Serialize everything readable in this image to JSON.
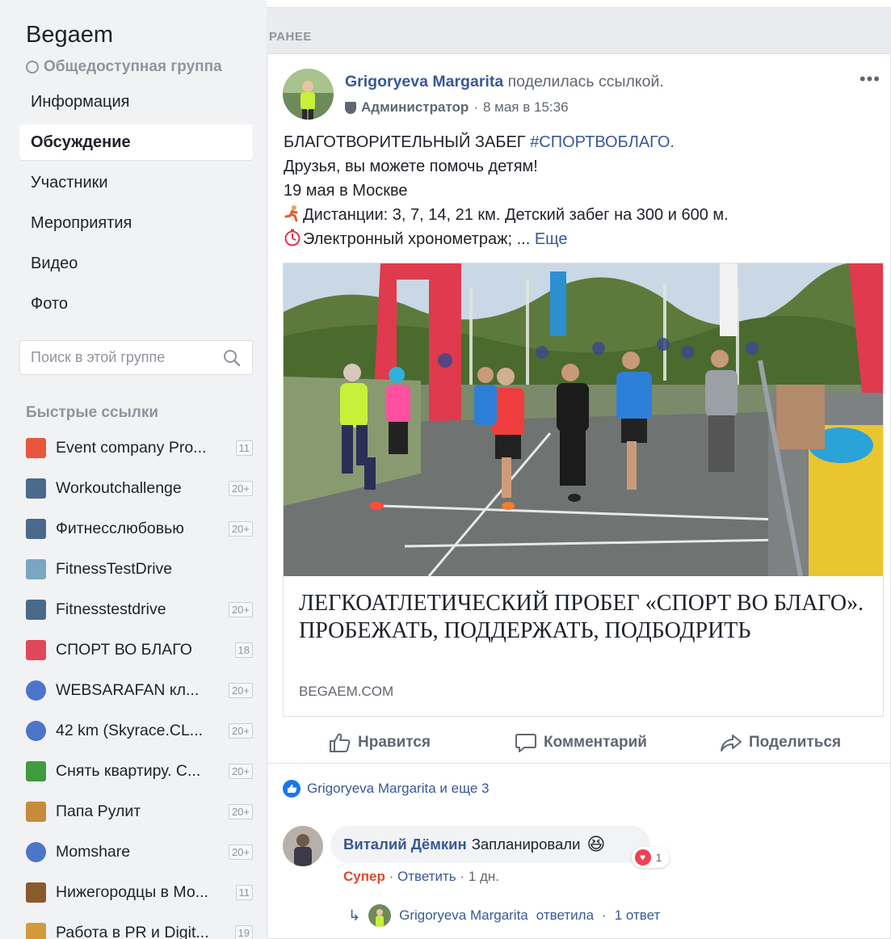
{
  "group": {
    "name": "Begaem",
    "privacy": "Общедоступная группа"
  },
  "nav": [
    {
      "label": "Информация"
    },
    {
      "label": "Обсуждение",
      "active": true
    },
    {
      "label": "Участники"
    },
    {
      "label": "Мероприятия"
    },
    {
      "label": "Видео"
    },
    {
      "label": "Фото"
    }
  ],
  "search": {
    "placeholder": "Поиск в этой группе"
  },
  "quick_links": {
    "title": "Быстрые ссылки",
    "items": [
      {
        "label": "Event company Pro...",
        "badge": "11",
        "icon": "event-company-icon",
        "color": "#e8573c"
      },
      {
        "label": "Workoutchallenge",
        "badge": "20+",
        "icon": "group-photo-icon",
        "color": "#4a6a8c"
      },
      {
        "label": "Фитнесслюбовью",
        "badge": "20+",
        "icon": "group-photo-icon",
        "color": "#4a6a8c"
      },
      {
        "label": "FitnessTestDrive",
        "badge": "",
        "icon": "sneaker-icon",
        "color": "#7aa6c2"
      },
      {
        "label": "Fitnesstestdrive",
        "badge": "20+",
        "icon": "group-photo-icon",
        "color": "#4a6a8c"
      },
      {
        "label": "СПОРТ ВО БЛАГО",
        "badge": "18",
        "icon": "heart-logo-icon",
        "color": "#e0485a"
      },
      {
        "label": "WEBSARAFAN кл...",
        "badge": "20+",
        "icon": "group-people-icon",
        "color": "#4c74c9"
      },
      {
        "label": "42 km (Skyrace.CL...",
        "badge": "20+",
        "icon": "group-people-icon",
        "color": "#4c74c9"
      },
      {
        "label": "Снять квартиру. С...",
        "badge": "20+",
        "icon": "tree-icon",
        "color": "#3f9b3f"
      },
      {
        "label": "Папа Рулит",
        "badge": "20+",
        "icon": "family-photo-icon",
        "color": "#c78a3a"
      },
      {
        "label": "Momshare",
        "badge": "20+",
        "icon": "group-people-icon",
        "color": "#4c74c9"
      },
      {
        "label": "Нижегородцы в Мо...",
        "badge": "11",
        "icon": "suitcase-icon",
        "color": "#8b5a2b"
      },
      {
        "label": "Работа в PR и Digit...",
        "badge": "19",
        "icon": "cookie-icon",
        "color": "#d49a3a"
      }
    ]
  },
  "feed": {
    "section_label": "РАНЕЕ"
  },
  "post": {
    "author": "Grigoryeva Margarita",
    "action": "поделилась ссылкой.",
    "role": "Администратор",
    "time": "8 мая в 15:36",
    "text": {
      "line1_prefix": "БЛАГОТВОРИТЕЛЬНЫЙ ЗАБЕГ",
      "hashtag": "#СПОРТВОБЛАГО.",
      "line2": "Друзья, вы можете помочь детям!",
      "line3": "19 мая в Москве",
      "line4": "Дистанции: 3, 7, 14, 21 км. Детский забег на 300 и 600 м.",
      "line5": "Электронный хронометраж; ...",
      "more": "Еще"
    },
    "link_card": {
      "title": "ЛЕГКОАТЛЕТИЧЕСКИЙ ПРОБЕГ «СПОРТ ВО БЛАГО». ПРОБЕЖАТЬ, ПОДДЕРЖАТЬ, ПОДБОДРИТЬ",
      "domain": "BEGAEM.COM"
    },
    "actions": {
      "like": "Нравится",
      "comment": "Комментарий",
      "share": "Поделиться"
    },
    "reactions_summary": "Grigoryeva Margarita и еще 3",
    "comment": {
      "author": "Виталий Дёмкин",
      "text": "Запланировали",
      "reaction_count": "1",
      "reaction_label": "Супер",
      "reply_label": "Ответить",
      "age": "1 дн."
    },
    "reply_summary": {
      "author": "Grigoryeva Margarita",
      "text": "ответила",
      "count": "1 ответ"
    }
  }
}
